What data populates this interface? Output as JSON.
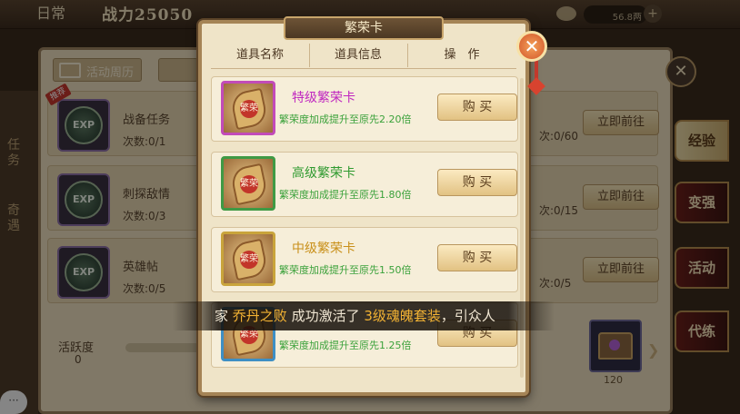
{
  "topbar": {
    "tab_label": "日常",
    "power_label": "战力",
    "power_value": "25050",
    "currency_value": "56.8两",
    "plus_glyph": "+"
  },
  "background_window": {
    "tabs": [
      {
        "label": "活动周历",
        "icon": "calendar-icon"
      }
    ],
    "side_text_top": "任务",
    "side_text_mid": "奇遇",
    "tasks": [
      {
        "name": "战备任务",
        "count": "次数:0/1",
        "right_count": "次:0/60",
        "button": "立即前往",
        "badge": "推荐",
        "icon_text": "EXP"
      },
      {
        "name": "刺探敌情",
        "count": "次数:0/3",
        "right_count": "次:0/15",
        "button": "立即前往",
        "icon_text": "EXP"
      },
      {
        "name": "英雄帖",
        "count": "次数:0/5",
        "right_count": "次:0/5",
        "button": "立即前往",
        "icon_text": "EXP"
      }
    ],
    "activity_label": "活跃度",
    "activity_value": "0",
    "chest_count": "120"
  },
  "side_tabs": [
    {
      "label": "经验",
      "active": true
    },
    {
      "label": "变强",
      "active": false
    },
    {
      "label": "活动",
      "active": false
    },
    {
      "label": "代练",
      "active": false
    }
  ],
  "modal": {
    "title": "繁荣卡",
    "close_glyph": "✕",
    "columns": [
      "道具名称",
      "道具信息",
      "操　作"
    ],
    "items": [
      {
        "name": "特级繁荣卡",
        "name_color": "purple",
        "desc": "繁荣度加成提升至原先2.20倍",
        "button": "购 买",
        "frame": "purple",
        "seal": "繁荣"
      },
      {
        "name": "高级繁荣卡",
        "name_color": "green",
        "desc": "繁荣度加成提升至原先1.80倍",
        "button": "购 买",
        "frame": "green",
        "seal": "繁荣"
      },
      {
        "name": "中级繁荣卡",
        "name_color": "gold",
        "desc": "繁荣度加成提升至原先1.50倍",
        "button": "购 买",
        "frame": "yellow",
        "seal": "繁荣"
      },
      {
        "name": "",
        "name_color": "blue",
        "desc": "繁荣度加成提升至原先1.25倍",
        "button": "购 买",
        "frame": "blue",
        "seal": "繁荣"
      }
    ]
  },
  "broadcast": {
    "prefix": "家 ",
    "player": "乔丹之败",
    "middle": " 成功激活了 ",
    "item": "3级魂魄套装",
    "suffix": "，引众人"
  },
  "colors": {
    "accent_gold": "#c9a363",
    "purple_name": "#c028c0",
    "green_name": "#2f9a2f",
    "gold_name": "#c9901a",
    "broadcast_highlight": "#f2b233"
  }
}
